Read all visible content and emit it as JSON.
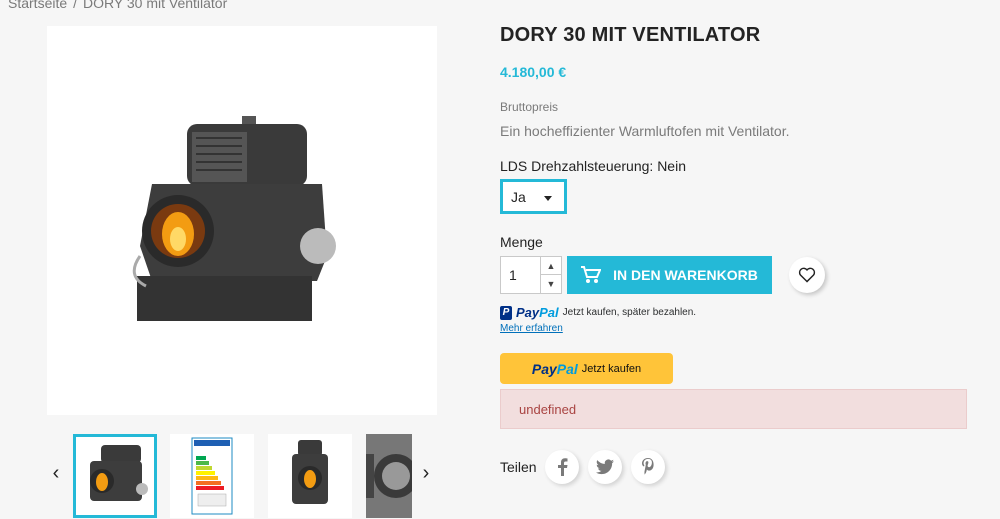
{
  "breadcrumb": {
    "home": "Startseite",
    "separator": "/",
    "current": "DORY 30 mit Ventilator"
  },
  "product": {
    "title": "DORY 30 MIT VENTILATOR",
    "price": "4.180,00 €",
    "tax_label": "Bruttopreis",
    "description": "Ein hocheffizienter Warmluftofen mit Ventilator.",
    "variant_label": "LDS Drehzahlsteuerung: Nein",
    "variant_selected": "Ja"
  },
  "quantity": {
    "label": "Menge",
    "value": "1"
  },
  "cart": {
    "button_label": "IN DEN WARENKORB"
  },
  "paypal": {
    "logo_pay": "Pay",
    "logo_pal": "Pal",
    "message": "Jetzt kaufen, später bezahlen.",
    "learn_more": "Mehr erfahren",
    "button_text": "Jetzt kaufen"
  },
  "alert": {
    "text": "undefined"
  },
  "share": {
    "label": "Teilen"
  },
  "thumbnails": {
    "prev_icon": "chevron-left-icon",
    "next_icon": "chevron-right-icon"
  },
  "colors": {
    "accent": "#24b9d7",
    "paypal_yellow": "#ffc439",
    "error_bg": "#f2dede",
    "error_text": "#a94442"
  }
}
